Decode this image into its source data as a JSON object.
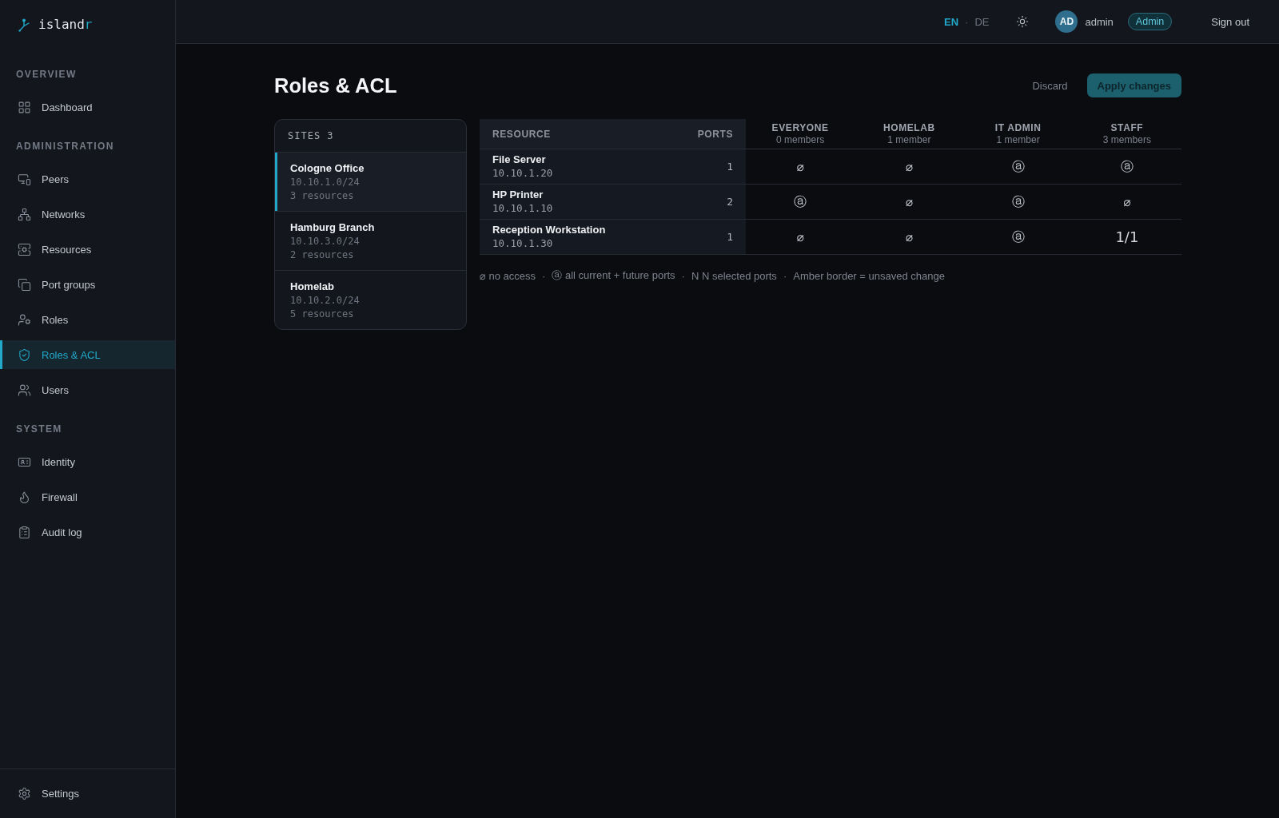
{
  "sidebar": {
    "logo": {
      "text": "island",
      "accent": "r"
    },
    "sections": [
      {
        "label": "OVERVIEW",
        "items": [
          {
            "label": "Dashboard",
            "selected": false
          }
        ]
      },
      {
        "label": "ADMINISTRATION",
        "items": [
          {
            "label": "Peers",
            "selected": false
          },
          {
            "label": "Networks",
            "selected": false
          },
          {
            "label": "Resources",
            "selected": false
          },
          {
            "label": "Port groups",
            "selected": false
          },
          {
            "label": "Roles",
            "selected": false
          },
          {
            "label": "Roles & ACL",
            "selected": true
          },
          {
            "label": "Users",
            "selected": false
          }
        ]
      },
      {
        "label": "SYSTEM",
        "items": [
          {
            "label": "Identity",
            "selected": false
          },
          {
            "label": "Firewall",
            "selected": false
          },
          {
            "label": "Audit log",
            "selected": false
          }
        ]
      }
    ],
    "footer_items": [
      {
        "label": "Settings",
        "selected": false
      }
    ]
  },
  "header": {
    "languages": [
      {
        "label": "EN",
        "selected": true
      },
      {
        "label": "DE",
        "selected": false
      }
    ],
    "language_separator": "·",
    "user": {
      "initials": "AD",
      "name": "admin",
      "role": "Admin"
    },
    "sign_out": "Sign out"
  },
  "page": {
    "title": "Roles & ACL",
    "actions": {
      "discard": "Discard",
      "apply": "Apply changes"
    }
  },
  "sites": {
    "title": "SITES",
    "count": "3",
    "items": [
      {
        "name": "Cologne Office",
        "subnet": "10.10.1.0/24",
        "resources": "3 resources",
        "selected": true
      },
      {
        "name": "Hamburg Branch",
        "subnet": "10.10.3.0/24",
        "resources": "2 resources",
        "selected": false
      },
      {
        "name": "Homelab",
        "subnet": "10.10.2.0/24",
        "resources": "5 resources",
        "selected": false
      }
    ]
  },
  "table": {
    "columns": [
      {
        "label": "RESOURCE"
      },
      {
        "label": "PORTS"
      }
    ],
    "roles": [
      {
        "name": "EVERYONE",
        "members": "0 members"
      },
      {
        "name": "HOMELAB",
        "members": "1 member"
      },
      {
        "name": "IT ADMIN",
        "members": "1 member"
      },
      {
        "name": "STAFF",
        "members": "3 members"
      }
    ],
    "rows": [
      {
        "name": "File Server",
        "address": "10.10.1.20",
        "ports": "1",
        "cells": [
          {
            "kind": "none",
            "value": "⌀"
          },
          {
            "kind": "none",
            "value": "⌀"
          },
          {
            "kind": "all",
            "value": "ⓐ"
          },
          {
            "kind": "all",
            "value": "ⓐ"
          }
        ]
      },
      {
        "name": "HP Printer",
        "address": "10.10.1.10",
        "ports": "2",
        "cells": [
          {
            "kind": "all",
            "value": "ⓐ"
          },
          {
            "kind": "none",
            "value": "⌀"
          },
          {
            "kind": "all",
            "value": "ⓐ"
          },
          {
            "kind": "none",
            "value": "⌀"
          }
        ]
      },
      {
        "name": "Reception Workstation",
        "address": "10.10.1.30",
        "ports": "1",
        "cells": [
          {
            "kind": "none",
            "value": "⌀"
          },
          {
            "kind": "none",
            "value": "⌀"
          },
          {
            "kind": "all",
            "value": "ⓐ"
          },
          {
            "kind": "ports",
            "value": "1/1"
          }
        ]
      }
    ]
  },
  "legend": {
    "separator": "·",
    "items": [
      "⌀ no access",
      "ⓐ all current + future ports",
      "N N selected ports",
      "Amber border = unsaved change"
    ]
  }
}
